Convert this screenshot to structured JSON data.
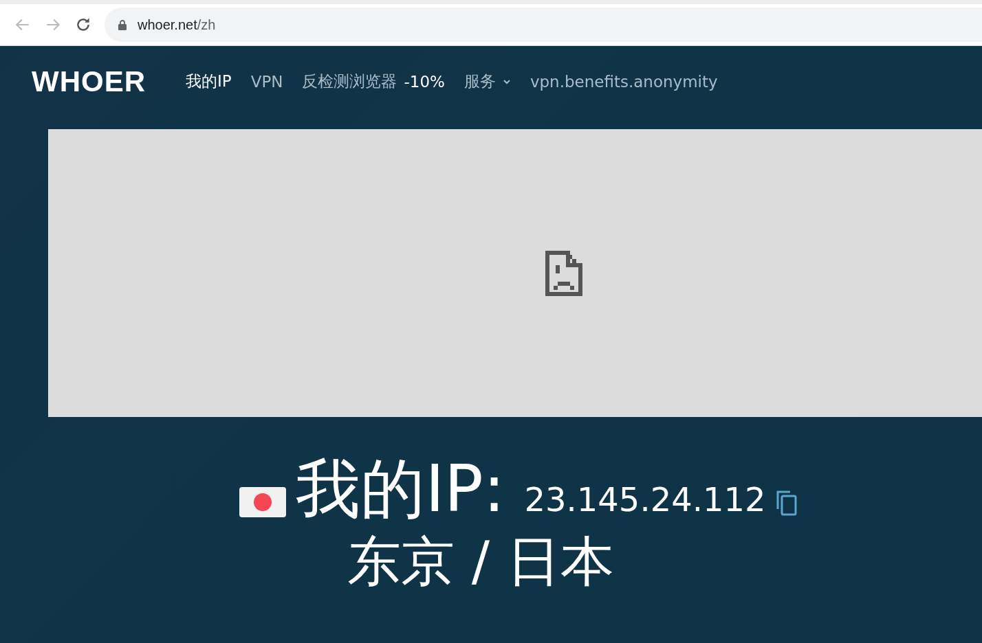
{
  "browser": {
    "url_host": "whoer.net",
    "url_path": "/zh"
  },
  "header": {
    "logo": "WHOER",
    "nav": [
      {
        "kind": "link",
        "label": "我的IP",
        "selected": true
      },
      {
        "kind": "link",
        "label": "VPN",
        "selected": false
      },
      {
        "kind": "promo",
        "label": "反检测浏览器",
        "badge": "-10%",
        "selected": false
      },
      {
        "kind": "dropdown",
        "label": "服务",
        "selected": false
      },
      {
        "kind": "link",
        "label": "vpn.benefits.anonymity",
        "selected": false
      }
    ]
  },
  "banner": {
    "kind": "broken-image"
  },
  "ip": {
    "title": "我的IP:",
    "address": "23.145.24.112",
    "location": "东京 / 日本"
  }
}
